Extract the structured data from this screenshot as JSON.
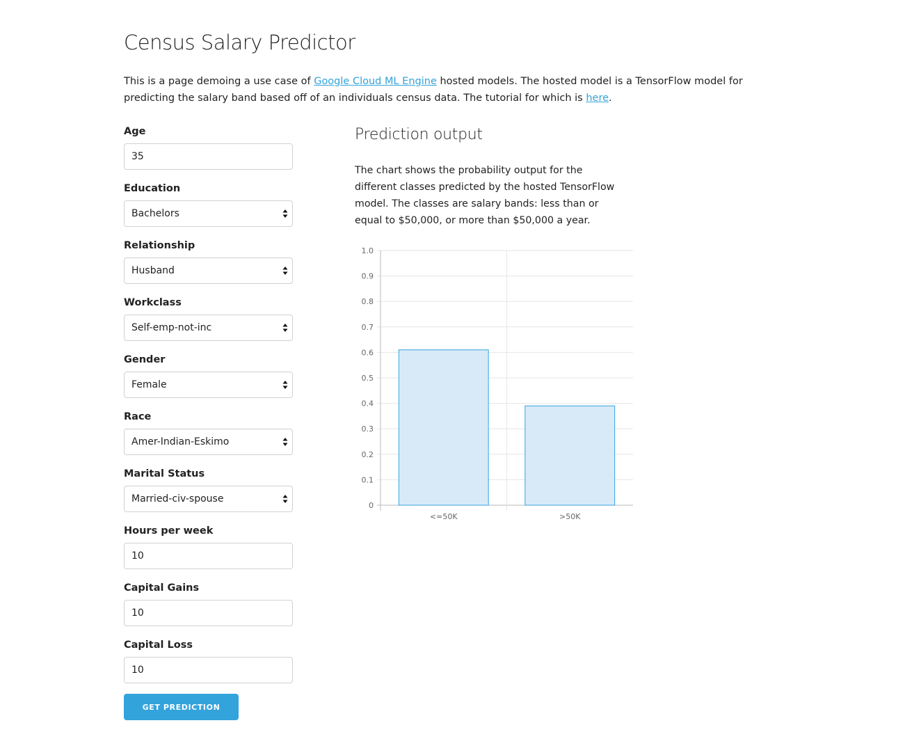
{
  "title": "Census Salary Predictor",
  "intro": {
    "text_before": "This is a page demoing a use case of ",
    "link1": "Google Cloud ML Engine",
    "text_middle": " hosted models. The hosted model is a TensorFlow model for predicting the salary band based off of an individuals census data. The tutorial for which is ",
    "link2": "here",
    "text_after": "."
  },
  "form": {
    "age": {
      "label": "Age",
      "value": "35"
    },
    "education": {
      "label": "Education",
      "value": "Bachelors"
    },
    "relationship": {
      "label": "Relationship",
      "value": "Husband"
    },
    "workclass": {
      "label": "Workclass",
      "value": "Self-emp-not-inc"
    },
    "gender": {
      "label": "Gender",
      "value": "Female"
    },
    "race": {
      "label": "Race",
      "value": "Amer-Indian-Eskimo"
    },
    "marital_status": {
      "label": "Marital Status",
      "value": "Married-civ-spouse"
    },
    "hours_per_week": {
      "label": "Hours per week",
      "value": "10"
    },
    "capital_gains": {
      "label": "Capital Gains",
      "value": "10"
    },
    "capital_loss": {
      "label": "Capital Loss",
      "value": "10"
    },
    "submit_label": "GET PREDICTION"
  },
  "output": {
    "heading": "Prediction output",
    "description": "The chart shows the probability output for the different classes predicted by the hosted TensorFlow model. The classes are salary bands: less than or equal to $50,000, or more than $50,000 a year."
  },
  "colors": {
    "accent": "#33a3dc",
    "bar_fill": "#d8eaf8",
    "bar_stroke": "#36a2e2"
  },
  "chart_data": {
    "type": "bar",
    "categories": [
      "<=50K",
      ">50K"
    ],
    "values": [
      0.61,
      0.39
    ],
    "ylim": [
      0,
      1.0
    ],
    "yticks": [
      "0",
      "0.1",
      "0.2",
      "0.3",
      "0.4",
      "0.5",
      "0.6",
      "0.7",
      "0.8",
      "0.9",
      "1.0"
    ],
    "grid": true
  }
}
